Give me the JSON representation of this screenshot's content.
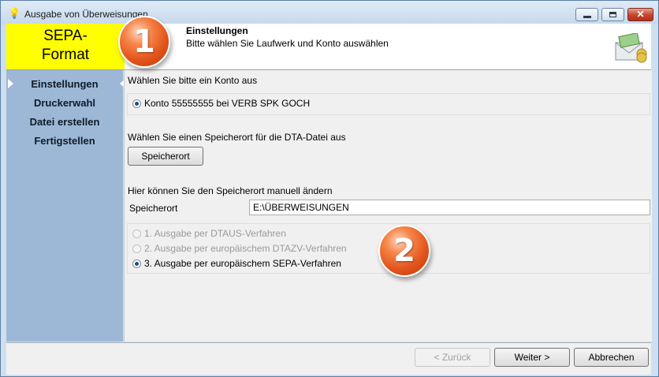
{
  "window": {
    "title": "Ausgabe von Überweisungen",
    "icon": "lightbulb-icon",
    "minimize_icon": "minimize-icon",
    "maximize_icon": "maximize-icon",
    "close_glyph": "✕"
  },
  "header": {
    "badge_line1": "SEPA-",
    "badge_line2": "Format",
    "title": "Einstellungen",
    "subtitle": "Bitte wählen Sie Laufwerk und Konto auswählen",
    "icon": "money-envelope-icon"
  },
  "sidebar": {
    "items": [
      {
        "label": "Einstellungen",
        "active": true
      },
      {
        "label": "Druckerwahl"
      },
      {
        "label": "Datei erstellen"
      },
      {
        "label": "Fertigstellen"
      }
    ]
  },
  "main": {
    "account_prompt": "Wählen Sie bitte ein Konto aus",
    "account_option": "Konto 55555555 bei VERB SPK GOCH",
    "storage_prompt": "Wählen Sie einen Speicherort für die DTA-Datei aus",
    "storage_button": "Speicherort",
    "manual_prompt": "Hier können Sie den Speicherort manuell ändern",
    "field_label": "Speicherort",
    "field_value": "E:\\ÜBERWEISUNGEN",
    "procedures": [
      {
        "label": "1. Ausgabe per DTAUS-Verfahren",
        "enabled": false,
        "selected": false
      },
      {
        "label": "2. Ausgabe per europäischem DTAZV-Verfahren",
        "enabled": false,
        "selected": false
      },
      {
        "label": "3. Ausgabe per europäischem SEPA-Verfahren",
        "enabled": true,
        "selected": true
      }
    ]
  },
  "footer": {
    "back": "< Zurück",
    "next": "Weiter >",
    "cancel": "Abbrechen"
  },
  "callouts": [
    "1",
    "2"
  ],
  "colors": {
    "badge_yellow": "#ffff00",
    "sidebar_blue": "#9db8d6",
    "callout_orange": "#e2541c"
  }
}
